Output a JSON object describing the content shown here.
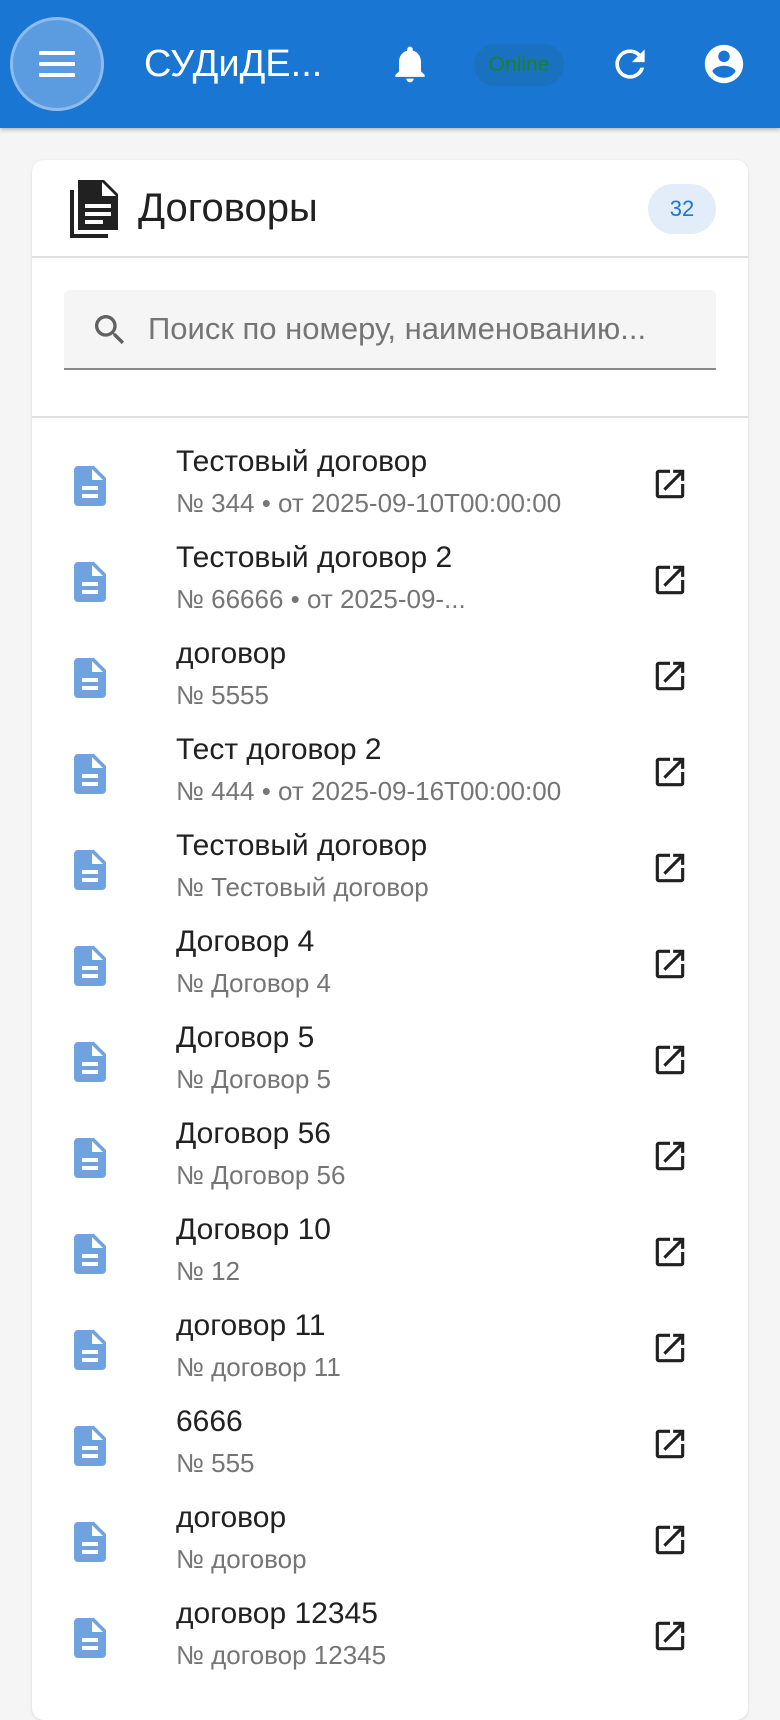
{
  "appbar": {
    "title": "СУДиДЕ...",
    "status": "Online",
    "background": "#1976d2"
  },
  "card": {
    "title": "Договоры",
    "count": "32"
  },
  "search": {
    "placeholder": "Поиск по номеру, наименованию...",
    "value": ""
  },
  "contracts": [
    {
      "title": "Тестовый договор",
      "subtitle": "№ 344 • от 2025-09-10T00:00:00"
    },
    {
      "title": "Тестовый договор 2",
      "subtitle": "№ 66666 • от 2025-09-..."
    },
    {
      "title": "договор",
      "subtitle": "№ 5555"
    },
    {
      "title": "Тест договор 2",
      "subtitle": "№ 444 • от 2025-09-16T00:00:00"
    },
    {
      "title": "Тестовый договор",
      "subtitle": "№ Тестовый договор"
    },
    {
      "title": "Договор 4",
      "subtitle": "№ Договор 4"
    },
    {
      "title": "Договор 5",
      "subtitle": "№ Договор 5"
    },
    {
      "title": "Договор 56",
      "subtitle": "№ Договор 56"
    },
    {
      "title": "Договор 10",
      "subtitle": "№ 12"
    },
    {
      "title": "договор 11",
      "subtitle": "№ договор 11"
    },
    {
      "title": "6666",
      "subtitle": "№ 555"
    },
    {
      "title": "договор",
      "subtitle": "№ договор"
    },
    {
      "title": "договор 12345",
      "subtitle": "№ договор 12345"
    }
  ],
  "icons": {
    "menu": "menu-icon",
    "notifications": "bell-icon",
    "refresh": "refresh-icon",
    "account": "account-circle-icon",
    "header": "document-stack-icon",
    "search": "search-icon",
    "item": "description-icon",
    "open": "open-in-new-icon"
  },
  "colors": {
    "primary": "#1976d2",
    "item_icon": "#6fa3e0",
    "status_text": "#1e7e34"
  }
}
